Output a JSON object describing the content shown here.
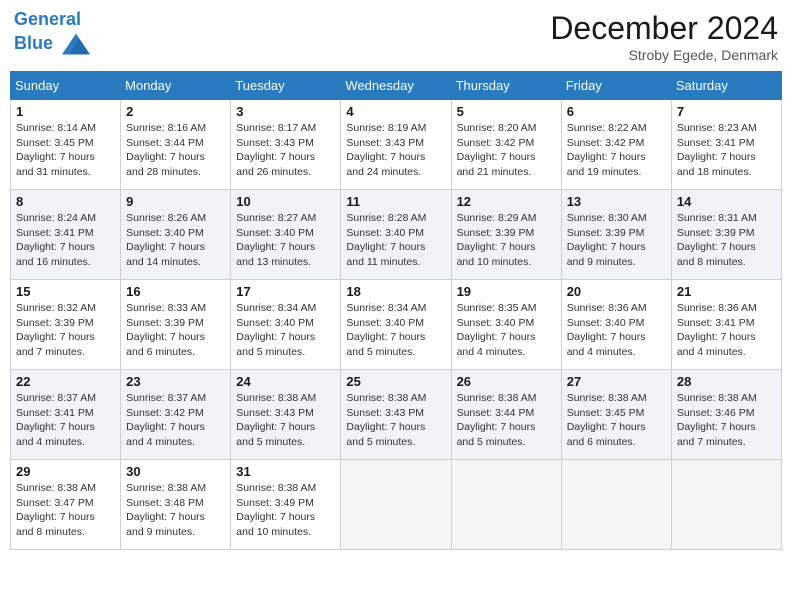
{
  "header": {
    "logo_line1": "General",
    "logo_line2": "Blue",
    "month": "December 2024",
    "location": "Stroby Egede, Denmark"
  },
  "weekdays": [
    "Sunday",
    "Monday",
    "Tuesday",
    "Wednesday",
    "Thursday",
    "Friday",
    "Saturday"
  ],
  "weeks": [
    [
      {
        "day": "1",
        "sunrise": "8:14 AM",
        "sunset": "3:45 PM",
        "daylight": "7 hours and 31 minutes."
      },
      {
        "day": "2",
        "sunrise": "8:16 AM",
        "sunset": "3:44 PM",
        "daylight": "7 hours and 28 minutes."
      },
      {
        "day": "3",
        "sunrise": "8:17 AM",
        "sunset": "3:43 PM",
        "daylight": "7 hours and 26 minutes."
      },
      {
        "day": "4",
        "sunrise": "8:19 AM",
        "sunset": "3:43 PM",
        "daylight": "7 hours and 24 minutes."
      },
      {
        "day": "5",
        "sunrise": "8:20 AM",
        "sunset": "3:42 PM",
        "daylight": "7 hours and 21 minutes."
      },
      {
        "day": "6",
        "sunrise": "8:22 AM",
        "sunset": "3:42 PM",
        "daylight": "7 hours and 19 minutes."
      },
      {
        "day": "7",
        "sunrise": "8:23 AM",
        "sunset": "3:41 PM",
        "daylight": "7 hours and 18 minutes."
      }
    ],
    [
      {
        "day": "8",
        "sunrise": "8:24 AM",
        "sunset": "3:41 PM",
        "daylight": "7 hours and 16 minutes."
      },
      {
        "day": "9",
        "sunrise": "8:26 AM",
        "sunset": "3:40 PM",
        "daylight": "7 hours and 14 minutes."
      },
      {
        "day": "10",
        "sunrise": "8:27 AM",
        "sunset": "3:40 PM",
        "daylight": "7 hours and 13 minutes."
      },
      {
        "day": "11",
        "sunrise": "8:28 AM",
        "sunset": "3:40 PM",
        "daylight": "7 hours and 11 minutes."
      },
      {
        "day": "12",
        "sunrise": "8:29 AM",
        "sunset": "3:39 PM",
        "daylight": "7 hours and 10 minutes."
      },
      {
        "day": "13",
        "sunrise": "8:30 AM",
        "sunset": "3:39 PM",
        "daylight": "7 hours and 9 minutes."
      },
      {
        "day": "14",
        "sunrise": "8:31 AM",
        "sunset": "3:39 PM",
        "daylight": "7 hours and 8 minutes."
      }
    ],
    [
      {
        "day": "15",
        "sunrise": "8:32 AM",
        "sunset": "3:39 PM",
        "daylight": "7 hours and 7 minutes."
      },
      {
        "day": "16",
        "sunrise": "8:33 AM",
        "sunset": "3:39 PM",
        "daylight": "7 hours and 6 minutes."
      },
      {
        "day": "17",
        "sunrise": "8:34 AM",
        "sunset": "3:40 PM",
        "daylight": "7 hours and 5 minutes."
      },
      {
        "day": "18",
        "sunrise": "8:34 AM",
        "sunset": "3:40 PM",
        "daylight": "7 hours and 5 minutes."
      },
      {
        "day": "19",
        "sunrise": "8:35 AM",
        "sunset": "3:40 PM",
        "daylight": "7 hours and 4 minutes."
      },
      {
        "day": "20",
        "sunrise": "8:36 AM",
        "sunset": "3:40 PM",
        "daylight": "7 hours and 4 minutes."
      },
      {
        "day": "21",
        "sunrise": "8:36 AM",
        "sunset": "3:41 PM",
        "daylight": "7 hours and 4 minutes."
      }
    ],
    [
      {
        "day": "22",
        "sunrise": "8:37 AM",
        "sunset": "3:41 PM",
        "daylight": "7 hours and 4 minutes."
      },
      {
        "day": "23",
        "sunrise": "8:37 AM",
        "sunset": "3:42 PM",
        "daylight": "7 hours and 4 minutes."
      },
      {
        "day": "24",
        "sunrise": "8:38 AM",
        "sunset": "3:43 PM",
        "daylight": "7 hours and 5 minutes."
      },
      {
        "day": "25",
        "sunrise": "8:38 AM",
        "sunset": "3:43 PM",
        "daylight": "7 hours and 5 minutes."
      },
      {
        "day": "26",
        "sunrise": "8:38 AM",
        "sunset": "3:44 PM",
        "daylight": "7 hours and 5 minutes."
      },
      {
        "day": "27",
        "sunrise": "8:38 AM",
        "sunset": "3:45 PM",
        "daylight": "7 hours and 6 minutes."
      },
      {
        "day": "28",
        "sunrise": "8:38 AM",
        "sunset": "3:46 PM",
        "daylight": "7 hours and 7 minutes."
      }
    ],
    [
      {
        "day": "29",
        "sunrise": "8:38 AM",
        "sunset": "3:47 PM",
        "daylight": "7 hours and 8 minutes."
      },
      {
        "day": "30",
        "sunrise": "8:38 AM",
        "sunset": "3:48 PM",
        "daylight": "7 hours and 9 minutes."
      },
      {
        "day": "31",
        "sunrise": "8:38 AM",
        "sunset": "3:49 PM",
        "daylight": "7 hours and 10 minutes."
      },
      null,
      null,
      null,
      null
    ]
  ]
}
